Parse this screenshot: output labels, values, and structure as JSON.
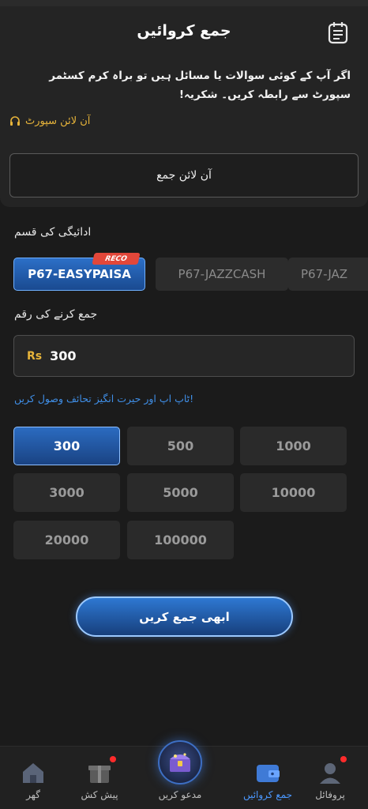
{
  "header": {
    "title": "جمع کروائیں"
  },
  "info": {
    "message": "اگر آپ کے کوئی سوالات یا مسائل ہیں تو براہ کرم کسٹمر سپورٹ سے رابطہ کریں۔ شکریہ!",
    "support_link": "آن لائن سپورٹ",
    "online_deposit_button": "آن لائن جمع"
  },
  "payment": {
    "label": "ادائیگی کی قسم",
    "badge": "RECO",
    "methods": [
      "P67-EASYPAISA",
      "P67-JAZZCASH",
      "P67-JAZ"
    ]
  },
  "amount": {
    "label": "جمع کرنے کی رقم",
    "currency": "Rs",
    "value": "300"
  },
  "promo_text": "!ٹاپ اپ اور حیرت انگیز تحائف وصول کریں",
  "presets": [
    "300",
    "500",
    "1000",
    "3000",
    "5000",
    "10000",
    "20000",
    "100000"
  ],
  "selected_preset": "300",
  "submit_label": "ابھی جمع کریں",
  "tabbar": {
    "items": [
      "گھر",
      "پیش کش",
      "مدعو کریں",
      "جمع کروائیں",
      "پروفائل"
    ],
    "active": "جمع کروائیں"
  },
  "colors": {
    "accent": "#2c6fc7",
    "gold": "#e7b43a",
    "badge": "#e2473a",
    "notify_dot": "#ff2b2b"
  }
}
